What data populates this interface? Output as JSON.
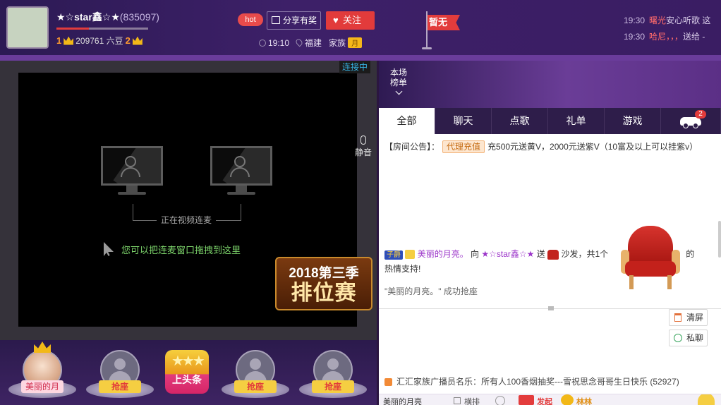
{
  "header": {
    "anchor_name": "★☆star鑫☆★",
    "anchor_id": "(835097)",
    "level_left": "1",
    "beans": "209761 六豆",
    "level_right": "2",
    "level_progress": 0.35,
    "hot_label": "hot",
    "share_label": "分享有奖",
    "follow_label": "关注",
    "live_time": "19:10",
    "location": "福建",
    "family_label": "家族",
    "family_tag": "月",
    "flag_text": "暂无",
    "ticker": [
      {
        "time": "19:30",
        "text": "曙光",
        "rest": "安心听歌 这"
      },
      {
        "time": "19:30",
        "text": "哈尼，，，",
        "rest": "送给 -"
      }
    ]
  },
  "video": {
    "status": "连接中",
    "linking_text": "正在视频连麦",
    "drag_hint": "您可以把连麦窗口拖拽到这里",
    "mute_label": "静音",
    "rank_year": "2018第三季",
    "rank_title": "排位赛"
  },
  "seats": [
    {
      "label": "美丽的月",
      "occupied": true
    },
    {
      "label": "抢座",
      "occupied": false
    },
    {
      "label": "上头条",
      "headline": true
    },
    {
      "label": "抢座",
      "occupied": false
    },
    {
      "label": "抢座",
      "occupied": false
    }
  ],
  "right": {
    "board_label": "本场榜单",
    "tabs": [
      "全部",
      "聊天",
      "点歌",
      "礼单",
      "游戏"
    ],
    "car_badge": "2",
    "notice_prefix": "【房间公告】：",
    "notice_tag": "代理充值",
    "notice_text": "充500元送黄V，2000元送紫V（10富及以上可以挂紫v）",
    "gift_msg": {
      "vip": "子爵",
      "user": "美丽的月亮。",
      "to": "向",
      "anchor": "★☆star鑫☆★",
      "send": "送",
      "item": "沙发，共1个",
      "user2": "月亮。",
      "tail": "的",
      "line2": "热情支持!"
    },
    "grab_msg": "\"美丽的月亮。\" 成功抢座",
    "clear_label": "清屏",
    "private_label": "私聊",
    "broadcast": "汇汇家族广播员名乐：所有人100香烟抽奖---雪祝思念哥哥生日快乐 (52927)",
    "target": "美丽的月亮",
    "check_label": "横排",
    "gift_label": "发起",
    "fan_label": "林林"
  },
  "colors": {
    "accent_red": "#e23b3b",
    "link_purple": "#9b34c9",
    "hint_green": "#7dd56b",
    "status_blue": "#36b4e5"
  }
}
